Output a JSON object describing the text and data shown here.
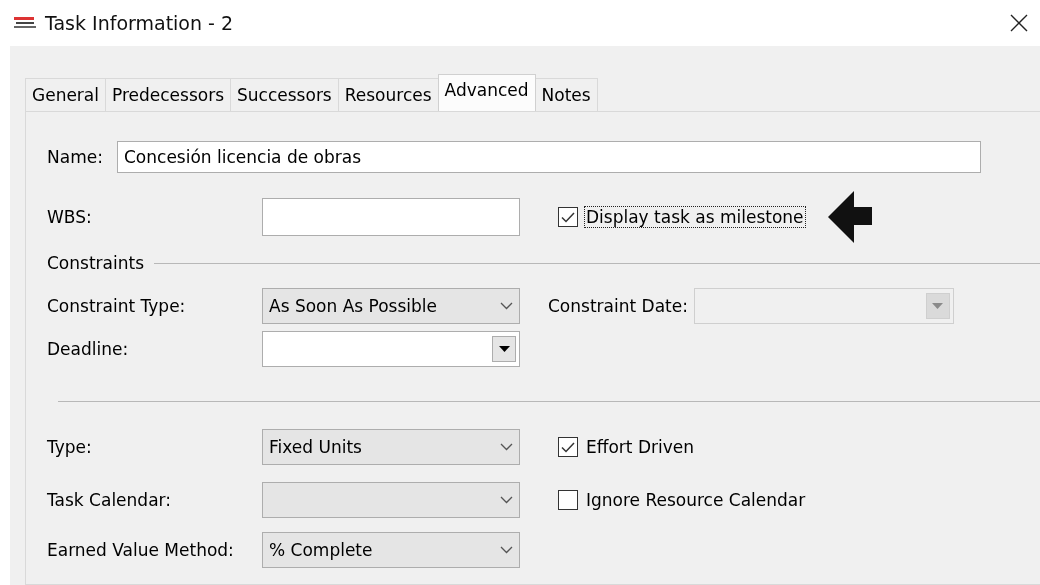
{
  "window": {
    "title": "Task Information - 2"
  },
  "tabs": [
    {
      "label": "General",
      "selected": false
    },
    {
      "label": "Predecessors",
      "selected": false
    },
    {
      "label": "Successors",
      "selected": false
    },
    {
      "label": "Resources",
      "selected": false
    },
    {
      "label": "Advanced",
      "selected": true
    },
    {
      "label": "Notes",
      "selected": false
    }
  ],
  "name": {
    "label": "Name:",
    "value": "Concesión licencia de obras"
  },
  "wbs": {
    "label": "WBS:"
  },
  "milestone": {
    "label": "Display task as milestone",
    "checked": true,
    "focused": true
  },
  "constraints": {
    "heading": "Constraints",
    "constraint_type": {
      "label": "Constraint Type:",
      "value": "As Soon As Possible",
      "kind": "combo",
      "disabled": false
    },
    "constraint_date": {
      "label": "Constraint Date:",
      "kind": "date",
      "disabled": true
    },
    "deadline": {
      "label": "Deadline:",
      "kind": "date",
      "disabled": false
    }
  },
  "type": {
    "label": "Type:",
    "value": "Fixed Units",
    "kind": "combo",
    "disabled": false
  },
  "effort_driven": {
    "label": "Effort Driven",
    "checked": true,
    "focused": false
  },
  "task_calendar": {
    "label": "Task Calendar:",
    "kind": "combo",
    "disabled": false
  },
  "ignore_resource_calendar": {
    "label": "Ignore Resource Calendar",
    "checked": false,
    "focused": false
  },
  "earned_value_method": {
    "label": "Earned Value Method:",
    "value": "% Complete",
    "kind": "combo",
    "disabled": false
  }
}
